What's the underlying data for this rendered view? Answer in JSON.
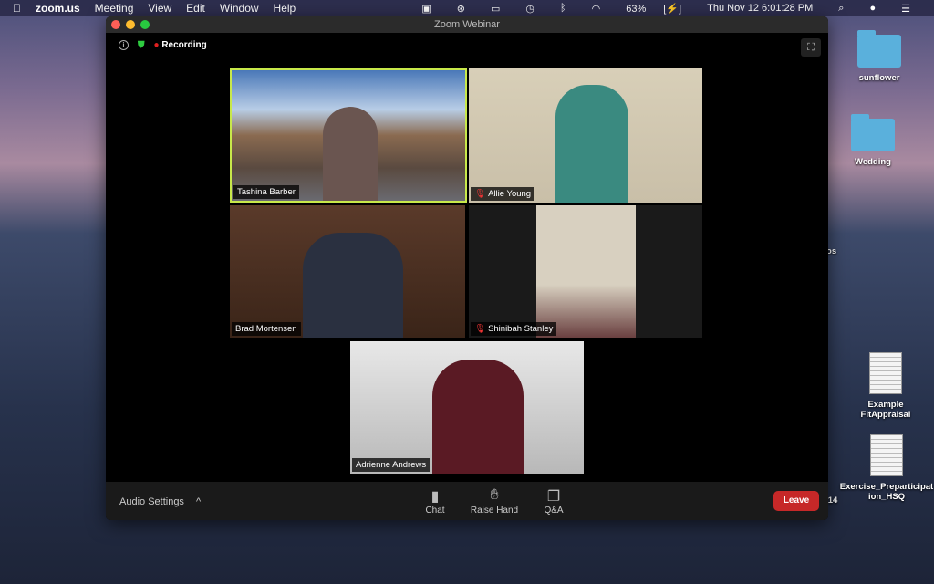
{
  "menubar": {
    "app": "zoom.us",
    "items": [
      "Meeting",
      "View",
      "Edit",
      "Window",
      "Help"
    ],
    "battery": "63%",
    "datetime": "Thu Nov 12  6:01:28 PM"
  },
  "desktop": {
    "items": [
      "sunflower",
      "Wedding",
      "Example FitAppraisal",
      "Exercise_Preparticipation_HSQ"
    ],
    "partial_labels": [
      "tos",
      "14"
    ]
  },
  "window": {
    "title": "Zoom Webinar",
    "recording": "Recording"
  },
  "participants": [
    {
      "name": "Tashina Barber",
      "muted": false,
      "active_speaker": true
    },
    {
      "name": "Allie Young",
      "muted": true
    },
    {
      "name": "Brad Mortensen",
      "muted": false
    },
    {
      "name": "Shinibah Stanley",
      "muted": true
    },
    {
      "name": "Adrienne Andrews",
      "muted": false
    }
  ],
  "toolbar": {
    "audio_settings": "Audio Settings",
    "chat": "Chat",
    "raise_hand": "Raise Hand",
    "qa": "Q&A",
    "leave": "Leave"
  },
  "colors": {
    "leave": "#c62828",
    "active_speaker": "#c8e84a",
    "recording": "#e02020"
  }
}
